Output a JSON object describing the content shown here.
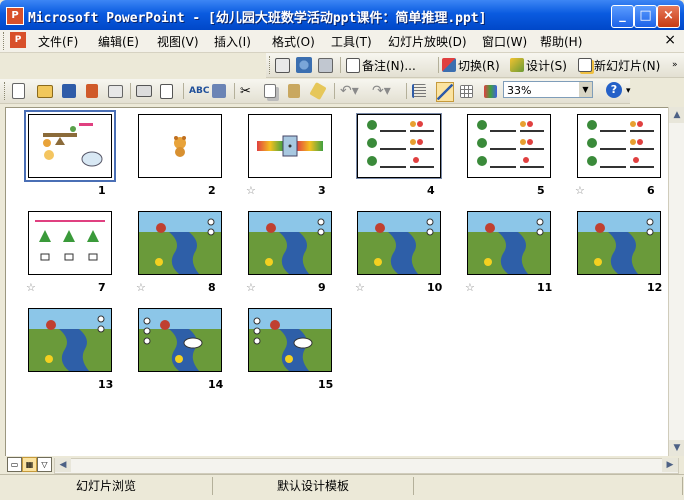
{
  "window": {
    "title": "Microsoft PowerPoint - [幼儿园大班数学活动ppt课件：简单推理.ppt]",
    "app_icon": "powerpoint-icon",
    "controls": [
      "minimize",
      "maximize",
      "close"
    ]
  },
  "menubar": {
    "items": [
      {
        "label": "文件(F)"
      },
      {
        "label": "编辑(E)"
      },
      {
        "label": "视图(V)"
      },
      {
        "label": "插入(I)"
      },
      {
        "label": "格式(O)"
      },
      {
        "label": "工具(T)"
      },
      {
        "label": "幻灯片放映(D)"
      },
      {
        "label": "窗口(W)"
      },
      {
        "label": "帮助(H)"
      }
    ],
    "close_glyph": "×"
  },
  "review_toolbar": {
    "notes_label": "备注(N)...",
    "transition_label": "切换(R)",
    "design_label": "设计(S)",
    "new_slide_label": "新幻灯片(N)"
  },
  "standard_toolbar": {
    "zoom_value": "33%",
    "help_glyph": "?"
  },
  "slides": [
    {
      "num": "1",
      "type": "balance",
      "star": false,
      "selected": true
    },
    {
      "num": "2",
      "type": "bear",
      "star": false
    },
    {
      "num": "3",
      "type": "beads",
      "star": true
    },
    {
      "num": "4",
      "type": "fruit",
      "star": false,
      "selected_border": true
    },
    {
      "num": "5",
      "type": "fruit",
      "star": false
    },
    {
      "num": "6",
      "type": "fruit",
      "star": true
    },
    {
      "num": "7",
      "type": "trees",
      "star": true
    },
    {
      "num": "8",
      "type": "river",
      "star": true
    },
    {
      "num": "9",
      "type": "river",
      "star": true
    },
    {
      "num": "10",
      "type": "river",
      "star": true
    },
    {
      "num": "11",
      "type": "river",
      "star": true
    },
    {
      "num": "12",
      "type": "river",
      "star": false
    },
    {
      "num": "13",
      "type": "river",
      "star": false
    },
    {
      "num": "14",
      "type": "river2",
      "star": false
    },
    {
      "num": "15",
      "type": "river2",
      "star": false
    }
  ],
  "statusbar": {
    "view_label": "幻灯片浏览",
    "template_label": "默认设计模板"
  }
}
